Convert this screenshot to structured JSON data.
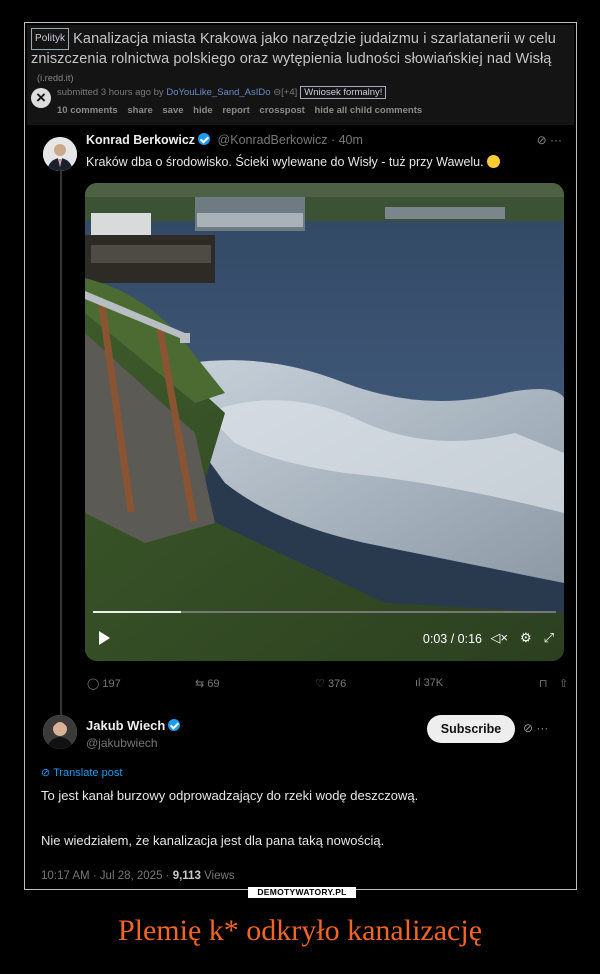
{
  "reddit": {
    "flair": "Polityk",
    "title": "Kanalizacja miasta Krakowa jako narzędzie judaizmu i szarlatanerii w celu zniszczenia rolnictwa polskiego oraz wytępienia ludności słowiańskiej nad Wisłą",
    "domain": "(i.redd.it)",
    "submitted_prefix": "submitted 3 hours ago by",
    "username": "DoYouLike_Sand_AsIDo",
    "plus": "[+4]",
    "user_tag": "Wniosek formalny!",
    "links": [
      "10 comments",
      "share",
      "save",
      "hide",
      "report",
      "crosspost",
      "hide all child comments"
    ]
  },
  "tweet": {
    "author": "Konrad Berkowicz",
    "handle": "@KonradBerkowicz · 40m",
    "text": "Kraków dba o środowisko. Ścieki wylewane do Wisły - tuż przy Wawelu.",
    "video": {
      "time": "0:03 / 0:16",
      "progress": 0.19
    },
    "stats": {
      "replies": "197",
      "reposts": "69",
      "likes": "376",
      "views": "37K"
    }
  },
  "reply": {
    "author": "Jakub Wiech",
    "handle": "@jakubwiech",
    "subscribe": "Subscribe",
    "translate": "Translate post",
    "line1": "To jest kanał burzowy odprowadzający do rzeki wodę deszczową.",
    "line2": "Nie wiedziałem, że kanalizacja jest dla pana taką nowością.",
    "date": "10:17 AM · Jul 28, 2025 ·",
    "views_count": "9,113",
    "views_label": "Views"
  },
  "watermark": "DEMOTYWATORY.PL",
  "caption": "Plemię k* odkryło kanalizację",
  "colors": {
    "caption": "#f26522",
    "link_blue": "#1d9bf0",
    "background": "#000000"
  }
}
